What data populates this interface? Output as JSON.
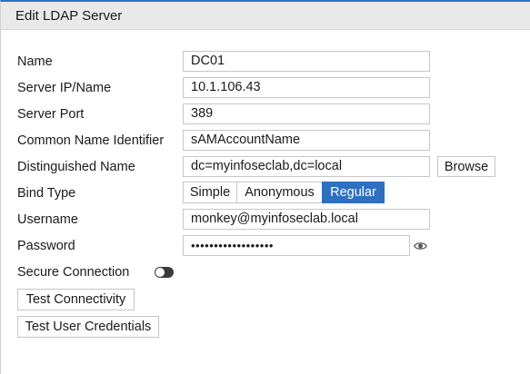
{
  "header": {
    "title": "Edit LDAP Server"
  },
  "form": {
    "name": {
      "label": "Name",
      "value": "DC01"
    },
    "server_ip": {
      "label": "Server IP/Name",
      "value": "10.1.106.43"
    },
    "server_port": {
      "label": "Server Port",
      "value": "389"
    },
    "cn_identifier": {
      "label": "Common Name Identifier",
      "value": "sAMAccountName"
    },
    "distinguished_name": {
      "label": "Distinguished Name",
      "value": "dc=myinfoseclab,dc=local",
      "browse_label": "Browse"
    },
    "bind_type": {
      "label": "Bind Type",
      "options": [
        "Simple",
        "Anonymous",
        "Regular"
      ],
      "selected": "Regular"
    },
    "username": {
      "label": "Username",
      "value": "monkey@myinfoseclab.local"
    },
    "password": {
      "label": "Password",
      "value": "••••••••••••••••••",
      "reveal_icon": "eye-icon"
    },
    "secure_connection": {
      "label": "Secure Connection",
      "enabled": false
    }
  },
  "actions": {
    "test_connectivity": "Test Connectivity",
    "test_user_credentials": "Test User Credentials"
  },
  "colors": {
    "accent": "#2f6fbf",
    "header_bg": "#e9e9e9",
    "toggle_off": "#3a3a3a"
  }
}
